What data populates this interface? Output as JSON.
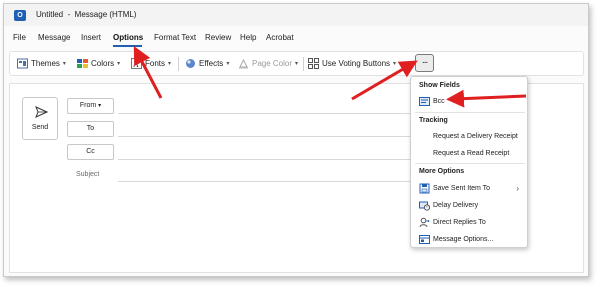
{
  "window": {
    "app_icon_letter": "O",
    "title": "Untitled  -  Message (HTML)"
  },
  "menu": {
    "items": [
      "File",
      "Message",
      "Insert",
      "Options",
      "Format Text",
      "Review",
      "Help",
      "Acrobat"
    ],
    "active": "Options"
  },
  "ribbon": {
    "themes_label": "Themes",
    "colors_label": "Colors",
    "fonts_label": "Fonts",
    "effects_label": "Effects",
    "page_color_label": "Page Color",
    "voting_label": "Use Voting Buttons",
    "more_label": "..."
  },
  "compose": {
    "send_label": "Send",
    "from_label": "From",
    "to_label": "To",
    "cc_label": "Cc",
    "subject_label": "Subject"
  },
  "dropdown": {
    "section_show_fields": "Show Fields",
    "bcc_label": "Bcc",
    "section_tracking": "Tracking",
    "delivery_receipt_label": "Request a Delivery Receipt",
    "read_receipt_label": "Request a Read Receipt",
    "section_more_options": "More Options",
    "save_sent_label": "Save Sent Item To",
    "delay_delivery_label": "Delay Delivery",
    "direct_replies_label": "Direct Replies To",
    "message_options_label": "Message Options..."
  },
  "colors": {
    "accent": "#1f5fb4",
    "annotation_arrow": "#e02020"
  },
  "icons": [
    "app-icon",
    "send-icon",
    "themes-icon",
    "colors-icon",
    "fonts-icon",
    "effects-icon",
    "page-color-icon",
    "voting-icon",
    "bcc-icon",
    "save-sent-icon",
    "delay-icon",
    "direct-replies-icon",
    "message-options-icon",
    "chevron-right-icon"
  ]
}
